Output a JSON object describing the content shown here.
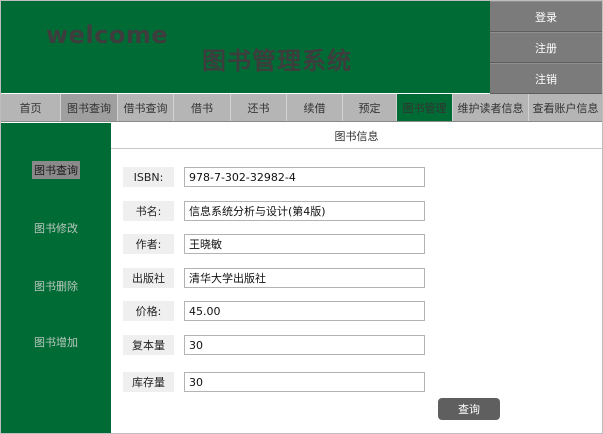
{
  "header": {
    "welcome": "welcome",
    "title": "图书管理系统"
  },
  "auth": [
    "登录",
    "注册",
    "注销"
  ],
  "nav": [
    "首页",
    "图书查询",
    "借书查询",
    "借书",
    "还书",
    "续借",
    "预定",
    "图书管理",
    "维护读者信息",
    "查看账户信息"
  ],
  "nav_active": "图书管理",
  "sidebar": [
    "图书查询",
    "图书修改",
    "图书删除",
    "图书增加"
  ],
  "sidebar_active": "图书查询",
  "content": {
    "title": "图书信息",
    "fields": [
      {
        "label": "ISBN:",
        "value": "978-7-302-32982-4"
      },
      {
        "label": "书名:",
        "value": "信息系统分析与设计(第4版)"
      },
      {
        "label": "作者:",
        "value": "王晓敏"
      },
      {
        "label": "出版社",
        "value": "清华大学出版社"
      },
      {
        "label": "价格:",
        "value": "45.00"
      },
      {
        "label": "复本量",
        "value": "30"
      },
      {
        "label": "库存量",
        "value": "30"
      }
    ],
    "submit": "查询"
  },
  "colors": {
    "brand_green": "#006b35",
    "nav_gray": "#b5b5b5",
    "button_gray": "#7b7b7b"
  }
}
